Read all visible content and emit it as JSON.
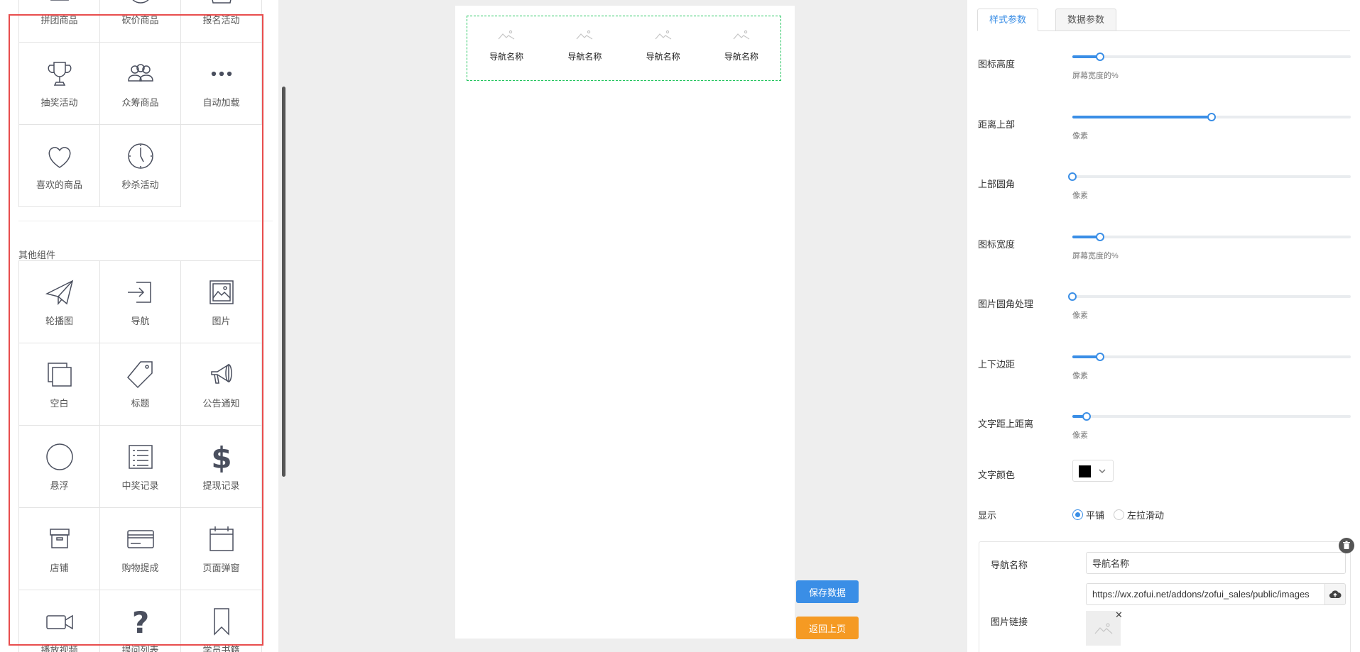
{
  "left_panel": {
    "top_items": [
      {
        "label": "拼团商品",
        "icon": "bag-icon"
      },
      {
        "label": "砍价商品",
        "icon": "circle-icon"
      },
      {
        "label": "报名活动",
        "icon": "basket-icon"
      },
      {
        "label": "抽奖活动",
        "icon": "trophy-icon"
      },
      {
        "label": "众筹商品",
        "icon": "people-icon"
      },
      {
        "label": "自动加载",
        "icon": "ellipsis-icon"
      },
      {
        "label": "喜欢的商品",
        "icon": "heart-icon"
      },
      {
        "label": "秒杀活动",
        "icon": "clock-icon"
      }
    ],
    "other_section_title": "其他组件",
    "other_items": [
      {
        "label": "轮播图",
        "icon": "paper-plane-icon"
      },
      {
        "label": "导航",
        "icon": "sign-in-icon"
      },
      {
        "label": "图片",
        "icon": "picture-icon"
      },
      {
        "label": "空白",
        "icon": "layers-icon"
      },
      {
        "label": "标题",
        "icon": "tag-icon"
      },
      {
        "label": "公告通知",
        "icon": "megaphone-icon"
      },
      {
        "label": "悬浮",
        "icon": "circle-outline-icon"
      },
      {
        "label": "中奖记录",
        "icon": "list-icon"
      },
      {
        "label": "提现记录",
        "icon": "dollar-icon"
      },
      {
        "label": "店铺",
        "icon": "archive-icon"
      },
      {
        "label": "购物提成",
        "icon": "credit-card-icon"
      },
      {
        "label": "页面弹窗",
        "icon": "calendar-icon"
      },
      {
        "label": "播放视频",
        "icon": "video-camera-icon"
      },
      {
        "label": "提问列表",
        "icon": "question-icon"
      },
      {
        "label": "学员书籍",
        "icon": "bookmark-icon"
      }
    ]
  },
  "preview": {
    "nav_items": [
      "导航名称",
      "导航名称",
      "导航名称",
      "导航名称"
    ]
  },
  "actions": {
    "save_label": "保存数据",
    "back_label": "返回上页"
  },
  "settings": {
    "tabs": [
      "样式参数",
      "数据参数"
    ],
    "sliders": [
      {
        "label": "图标高度",
        "unit": "屏幕宽度的%",
        "value": 0.1
      },
      {
        "label": "距离上部",
        "unit": "像素",
        "value": 0.5
      },
      {
        "label": "上部圆角",
        "unit": "像素",
        "value": 0.0
      },
      {
        "label": "图标宽度",
        "unit": "屏幕宽度的%",
        "value": 0.1
      },
      {
        "label": "图片圆角处理",
        "unit": "像素",
        "value": 0.0
      },
      {
        "label": "上下边距",
        "unit": "像素",
        "value": 0.1
      },
      {
        "label": "文字距上距离",
        "unit": "像素",
        "value": 0.05
      }
    ],
    "text_color_label": "文字颜色",
    "text_color": "#000000",
    "display_label": "显示",
    "display_options": [
      "平铺",
      "左拉滑动"
    ],
    "display_selected": "平铺",
    "nav_card": {
      "name_label": "导航名称",
      "name_value": "导航名称",
      "image_label": "图片链接",
      "image_value": "https://wx.zofui.net/addons/zofui_sales/public/images"
    }
  },
  "colors": {
    "accent": "#3a8ee6",
    "save_button": "#3a8ee6",
    "back_button": "#f59a23",
    "highlight_border": "#e84d4d",
    "selection_border": "#22c55e"
  }
}
